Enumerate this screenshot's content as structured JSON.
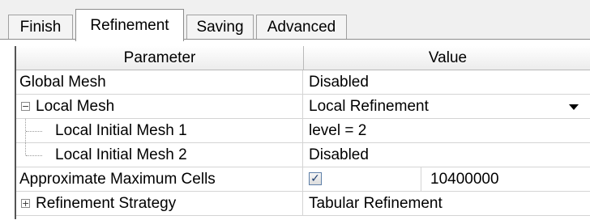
{
  "tabs": [
    {
      "label": "Finish",
      "active": false
    },
    {
      "label": "Refinement",
      "active": true
    },
    {
      "label": "Saving",
      "active": false
    },
    {
      "label": "Advanced",
      "active": false
    }
  ],
  "grid": {
    "header": {
      "parameter": "Parameter",
      "value": "Value"
    },
    "rows": [
      {
        "parameter": "Global Mesh",
        "value": "Disabled"
      },
      {
        "parameter": "Local Mesh",
        "value": "Local Refinement",
        "expanded": true,
        "dropdown": true
      },
      {
        "parameter": "Local Initial Mesh 1",
        "value": "level = 2"
      },
      {
        "parameter": "Local Initial Mesh 2",
        "value": "Disabled"
      },
      {
        "parameter": "Approximate Maximum Cells",
        "checked": true,
        "value": "10400000"
      },
      {
        "parameter": "Refinement Strategy",
        "value": "Tabular Refinement",
        "expanded": false
      }
    ]
  },
  "icons": {
    "expand_minus": "minus-box-icon",
    "expand_plus": "plus-box-icon",
    "dropdown": "chevron-down-icon",
    "checkbox": "checkbox-checked-icon"
  }
}
